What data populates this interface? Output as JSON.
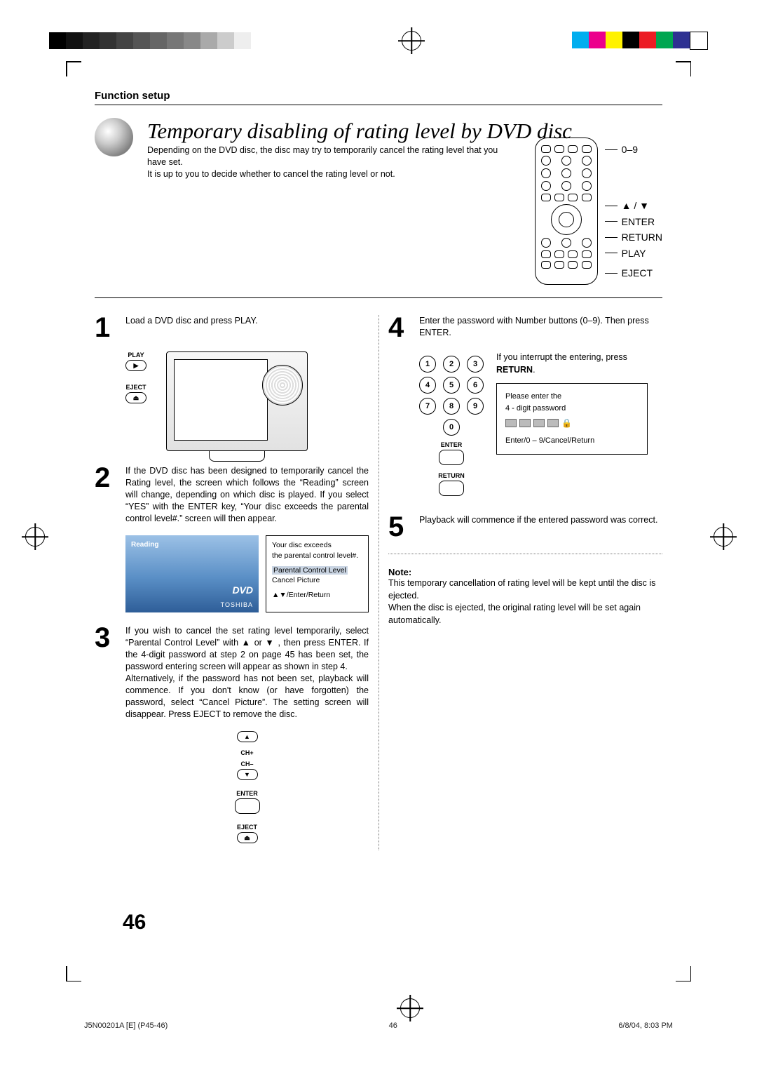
{
  "section_head": "Function setup",
  "title": "Temporary disabling of rating level by DVD disc",
  "intro_line1": "Depending on the DVD disc, the disc may try to temporarily cancel the rating level that you have set.",
  "intro_line2": "It is up to you to decide whether to cancel the rating level or not.",
  "remote_labels": {
    "l1": "0–9",
    "l2": "▲ / ▼",
    "l3": "ENTER",
    "l4": "RETURN",
    "l5": "PLAY",
    "l6": "EJECT"
  },
  "steps": {
    "s1": {
      "num": "1",
      "text": "Load a DVD disc and press PLAY."
    },
    "s1_btn_play": "PLAY",
    "s1_btn_play_sym": "▶",
    "s1_btn_eject": "EJECT",
    "s1_btn_eject_sym": "⏏",
    "s2": {
      "num": "2",
      "text": "If the DVD disc has been designed to temporarily cancel the Rating level, the screen which follows the “Reading” screen will change, depending on which disc is played. If you select “YES” with the ENTER key, “Your disc exceeds the parental control level#.” screen will then appear."
    },
    "osd_reading": "Reading",
    "osd_dvd": "DVD",
    "osd_brand": "TOSHIBA",
    "osd_side_l1": "Your disc exceeds",
    "osd_side_l2": "the parental control level#.",
    "osd_side_hl": "Parental Control Level",
    "osd_side_l3": "Cancel Picture",
    "osd_side_l4": "▲▼/Enter/Return",
    "s3": {
      "num": "3",
      "text": "If you wish to cancel the set rating level temporarily, select “Parental Control Level” with ▲ or ▼ , then press ENTER. If the 4-digit password at step 2 on page 45 has been set, the password entering screen will appear as shown in step 4."
    },
    "s3_extra": "Alternatively, if the password has not been set, playback will commence. If you don't know (or have forgotten) the password, select “Cancel Picture”. The setting screen will disappear. Press EJECT to remove the disc.",
    "s3_btns": {
      "chup": "CH+",
      "chdn": "CH–",
      "enter": "ENTER",
      "eject": "EJECT",
      "up": "▲",
      "dn": "▼",
      "ej": "⏏"
    },
    "s4": {
      "num": "4",
      "text": "Enter the password with Number buttons (0–9). Then press ENTER."
    },
    "s4_hint1": "If you interrupt the entering, press ",
    "s4_hint_bold": "RETURN",
    "s4_hint2": ".",
    "numpad": [
      "1",
      "2",
      "3",
      "4",
      "5",
      "6",
      "7",
      "8",
      "9",
      "0"
    ],
    "np_enter": "ENTER",
    "np_return": "RETURN",
    "pw_l1": "Please enter the",
    "pw_l2": "4 - digit password",
    "pw_l3": "Enter/0 – 9/Cancel/Return",
    "s5": {
      "num": "5",
      "text": "Playback will commence if the entered password was correct."
    }
  },
  "note_head": "Note:",
  "note_body1": "This temporary cancellation of rating level will be kept until the disc is ejected.",
  "note_body2": "When the disc is ejected, the original rating level will be set again automatically.",
  "page_number": "46",
  "footer_left": "J5N00201A [E] (P45-46)",
  "footer_mid": "46",
  "footer_right": "6/8/04, 8:03 PM"
}
